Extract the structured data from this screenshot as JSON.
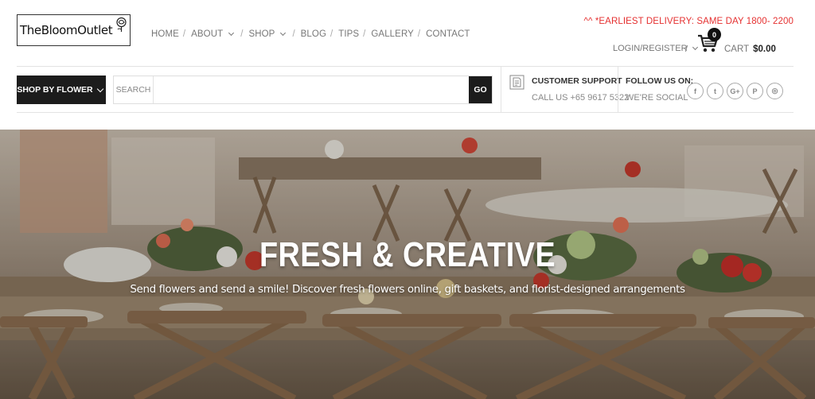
{
  "logo": {
    "text": "TheBloomOutlet"
  },
  "nav": {
    "items": [
      {
        "label": "HOME"
      },
      {
        "label": "ABOUT"
      },
      {
        "label": "SHOP"
      },
      {
        "label": "BLOG"
      },
      {
        "label": "TIPS"
      },
      {
        "label": "GALLERY"
      },
      {
        "label": "CONTACT"
      }
    ],
    "separator": "/"
  },
  "topbar": {
    "delivery_notice": "^^ *EARLIEST DELIVERY: SAME DAY 1800- 2200",
    "login_label": "LOGIN/REGISTER",
    "separator": "/",
    "cart_count": "0",
    "cart_label": "CART",
    "cart_total": "$0.00"
  },
  "searchbar": {
    "shop_by_label": "SHOP BY FLOWER",
    "search_label": "SEARCH",
    "search_value": "",
    "go_label": "GO"
  },
  "support": {
    "title": "CUSTOMER SUPPORT",
    "phone": "CALL US +65 9617 5322"
  },
  "social": {
    "title": "FOLLOW US ON:",
    "subtitle": "WE'RE SOCIAL",
    "icons": [
      "facebook-icon",
      "twitter-icon",
      "google-plus-icon",
      "pinterest-icon",
      "instagram-icon"
    ],
    "glyphs": [
      "f",
      "t",
      "G+",
      "P",
      "◎"
    ]
  },
  "hero": {
    "title": "FRESH & CREATIVE",
    "subtitle": "Send flowers and send a smile! Discover fresh flowers online, gift baskets, and florist-designed arrangements"
  },
  "colors": {
    "accent_red": "#e53030",
    "dark": "#1c1c1c"
  }
}
